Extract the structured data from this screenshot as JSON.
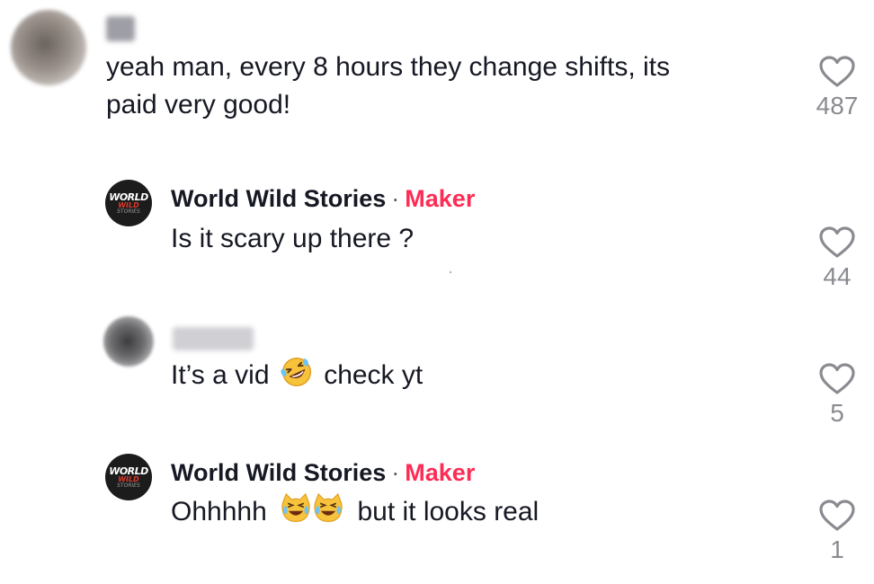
{
  "comments": [
    {
      "author": "",
      "text_line1": "yeah man, every 8 hours they change shifts, its",
      "text_line2": "paid very good!",
      "likes": "487"
    },
    {
      "author": "World Wild Stories",
      "separator": "·",
      "badge": "Maker",
      "text": "Is it scary up there ?",
      "likes": "44"
    },
    {
      "author": "",
      "text_before": "It’s a vid",
      "text_after": "check yt",
      "emoji": "rolling-on-floor-laughing",
      "likes": "5"
    },
    {
      "author": "World Wild Stories",
      "separator": "·",
      "badge": "Maker",
      "text_before": "Ohhhhh",
      "text_after": "but it looks real",
      "emoji": "cat-with-tears-of-joy",
      "likes": "1"
    }
  ],
  "logo": {
    "line1": "WORLD",
    "line2": "WILD",
    "line3": "STORIES"
  },
  "colors": {
    "text": "#161823",
    "maker": "#fe2c55",
    "muted": "#8a8b91"
  }
}
